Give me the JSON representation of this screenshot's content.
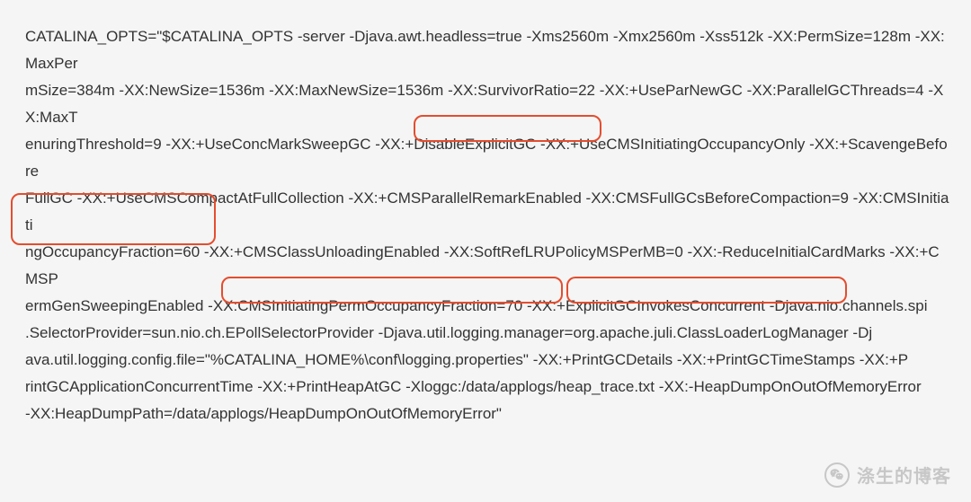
{
  "lines": [
    "CATALINA_OPTS=\"$CATALINA_OPTS -server -Djava.awt.headless=true -Xms2560m -Xmx2560m -Xss512k -XX:PermSize=128m -XX:MaxPer",
    "mSize=384m -XX:NewSize=1536m -XX:MaxNewSize=1536m -XX:SurvivorRatio=22 -XX:+UseParNewGC -XX:ParallelGCThreads=4 -XX:MaxT",
    "enuringThreshold=9 -XX:+UseConcMarkSweepGC -XX:+DisableExplicitGC -XX:+UseCMSInitiatingOccupancyOnly -XX:+ScavengeBefore",
    "FullGC -XX:+UseCMSCompactAtFullCollection -XX:+CMSParallelRemarkEnabled -XX:CMSFullGCsBeforeCompaction=9 -XX:CMSInitiati",
    "ngOccupancyFraction=60 -XX:+CMSClassUnloadingEnabled -XX:SoftRefLRUPolicyMSPerMB=0 -XX:-ReduceInitialCardMarks -XX:+CMSP",
    "ermGenSweepingEnabled -XX:CMSInitiatingPermOccupancyFraction=70 -XX:+ExplicitGCInvokesConcurrent -Djava.nio.channels.spi",
    ".SelectorProvider=sun.nio.ch.EPollSelectorProvider -Djava.util.logging.manager=org.apache.juli.ClassLoaderLogManager -Dj",
    "ava.util.logging.config.file=\"%CATALINA_HOME%\\conf\\logging.properties\" -XX:+PrintGCDetails -XX:+PrintGCTimeStamps -XX:+P",
    "rintGCApplicationConcurrentTime -XX:+PrintHeapAtGC -Xloggc:/data/applogs/heap_trace.txt -XX:-HeapDumpOnOutOfMemoryError",
    "-XX:HeapDumpPath=/data/applogs/HeapDumpOnOutOfMemoryError\""
  ],
  "highlights": [
    {
      "id": "hl1",
      "label": "-XX:+DisableExplicitGC"
    },
    {
      "id": "hl2",
      "label": "-XX:CMSInitiatingOccupancyFraction=60"
    },
    {
      "id": "hl3",
      "label": "-XX:CMSInitiatingPermOccupancyFraction=70"
    },
    {
      "id": "hl4",
      "label": "-XX:+ExplicitGCInvokesConcurrent"
    }
  ],
  "watermark": {
    "text": "涤生的博客",
    "icon": "wechat-icon"
  }
}
